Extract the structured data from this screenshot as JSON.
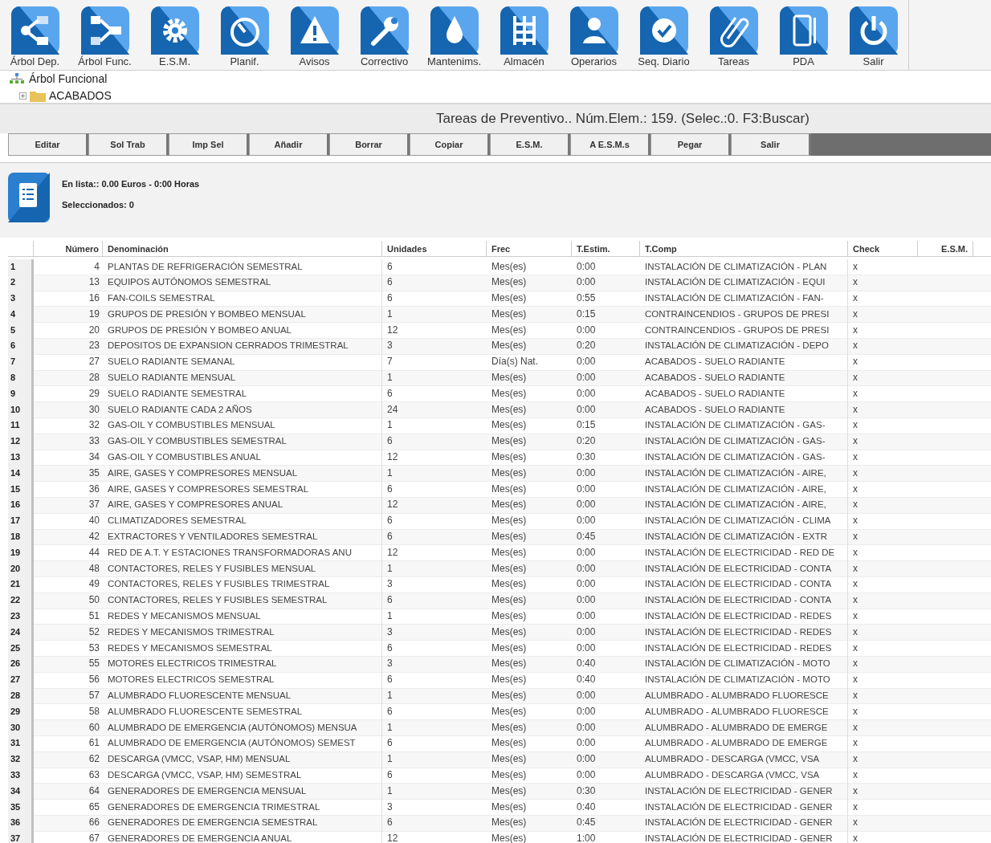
{
  "toolbar": [
    {
      "label": "Árbol Dep."
    },
    {
      "label": "Árbol Func."
    },
    {
      "label": "E.S.M."
    },
    {
      "label": "Planif."
    },
    {
      "label": "Avisos"
    },
    {
      "label": "Correctivo"
    },
    {
      "label": "Mantenims."
    },
    {
      "label": "Almacén"
    },
    {
      "label": "Operarios"
    },
    {
      "label": "Seq. Diario"
    },
    {
      "label": "Tareas"
    },
    {
      "label": "PDA"
    },
    {
      "label": "Salir"
    }
  ],
  "tree": {
    "root": "Árbol Funcional",
    "children": [
      {
        "label": "ACABADOS"
      }
    ]
  },
  "panel_title": "Tareas de Preventivo.. Núm.Elem.: 159. (Selec.:0. F3:Buscar)",
  "actions": [
    "Editar",
    "Sol Trab",
    "Imp Sel",
    "Añadir",
    "Borrar",
    "Copiar",
    "E.S.M.",
    "A E.S.M.s",
    "Pegar",
    "Salir"
  ],
  "summary": {
    "list": "En lista:: 0.00 Euros - 0:00 Horas",
    "selected": "Seleccionados: 0"
  },
  "table": {
    "columns": [
      "",
      "Número",
      "Denominación",
      "Unidades",
      "Frec",
      "T.Estim.",
      "T.Comp",
      "Check",
      "E.S.M."
    ],
    "rows": [
      [
        "1",
        "4",
        "PLANTAS DE REFRIGERACIÓN SEMESTRAL",
        "6",
        "Mes(es)",
        "0:00",
        "INSTALACIÓN DE CLIMATIZACIÓN - PLAN",
        "x"
      ],
      [
        "2",
        "13",
        "EQUIPOS AUTÓNOMOS SEMESTRAL",
        "6",
        "Mes(es)",
        "0:00",
        "INSTALACIÓN DE CLIMATIZACIÓN - EQUI",
        "x"
      ],
      [
        "3",
        "16",
        "FAN-COILS SEMESTRAL",
        "6",
        "Mes(es)",
        "0:55",
        "INSTALACIÓN DE CLIMATIZACIÓN - FAN-",
        "x"
      ],
      [
        "4",
        "19",
        "GRUPOS DE PRESIÓN Y BOMBEO MENSUAL",
        "1",
        "Mes(es)",
        "0:15",
        "CONTRAINCENDIOS - GRUPOS DE PRESI",
        "x"
      ],
      [
        "5",
        "20",
        "GRUPOS DE PRESIÓN Y BOMBEO ANUAL",
        "12",
        "Mes(es)",
        "0:00",
        "CONTRAINCENDIOS - GRUPOS DE PRESI",
        "x"
      ],
      [
        "6",
        "23",
        "DEPOSITOS DE EXPANSION CERRADOS TRIMESTRAL",
        "3",
        "Mes(es)",
        "0:20",
        "INSTALACIÓN DE CLIMATIZACIÓN - DEPO",
        "x"
      ],
      [
        "7",
        "27",
        "SUELO RADIANTE SEMANAL",
        "7",
        "Día(s) Nat.",
        "0:00",
        "ACABADOS - SUELO RADIANTE",
        "x"
      ],
      [
        "8",
        "28",
        "SUELO RADIANTE MENSUAL",
        "1",
        "Mes(es)",
        "0:00",
        "ACABADOS - SUELO RADIANTE",
        "x"
      ],
      [
        "9",
        "29",
        "SUELO RADIANTE SEMESTRAL",
        "6",
        "Mes(es)",
        "0:00",
        "ACABADOS - SUELO RADIANTE",
        "x"
      ],
      [
        "10",
        "30",
        "SUELO RADIANTE CADA 2 AÑOS",
        "24",
        "Mes(es)",
        "0:00",
        "ACABADOS - SUELO RADIANTE",
        "x"
      ],
      [
        "11",
        "32",
        "GAS-OIL Y COMBUSTIBLES MENSUAL",
        "1",
        "Mes(es)",
        "0:15",
        "INSTALACIÓN DE CLIMATIZACIÓN - GAS-",
        "x"
      ],
      [
        "12",
        "33",
        "GAS-OIL Y COMBUSTIBLES SEMESTRAL",
        "6",
        "Mes(es)",
        "0:20",
        "INSTALACIÓN DE CLIMATIZACIÓN - GAS-",
        "x"
      ],
      [
        "13",
        "34",
        "GAS-OIL Y COMBUSTIBLES ANUAL",
        "12",
        "Mes(es)",
        "0:30",
        "INSTALACIÓN DE CLIMATIZACIÓN - GAS-",
        "x"
      ],
      [
        "14",
        "35",
        "AIRE, GASES Y COMPRESORES MENSUAL",
        "1",
        "Mes(es)",
        "0:00",
        "INSTALACIÓN DE CLIMATIZACIÓN - AIRE,",
        "x"
      ],
      [
        "15",
        "36",
        "AIRE, GASES Y COMPRESORES SEMESTRAL",
        "6",
        "Mes(es)",
        "0:00",
        "INSTALACIÓN DE CLIMATIZACIÓN - AIRE,",
        "x"
      ],
      [
        "16",
        "37",
        "AIRE, GASES Y COMPRESORES ANUAL",
        "12",
        "Mes(es)",
        "0:00",
        "INSTALACIÓN DE CLIMATIZACIÓN - AIRE,",
        "x"
      ],
      [
        "17",
        "40",
        "CLIMATIZADORES SEMESTRAL",
        "6",
        "Mes(es)",
        "0:00",
        "INSTALACIÓN DE CLIMATIZACIÓN - CLIMA",
        "x"
      ],
      [
        "18",
        "42",
        "EXTRACTORES Y VENTILADORES SEMESTRAL",
        "6",
        "Mes(es)",
        "0:45",
        "INSTALACIÓN DE CLIMATIZACIÓN - EXTR",
        "x"
      ],
      [
        "19",
        "44",
        "RED DE A.T. Y ESTACIONES TRANSFORMADORAS ANU",
        "12",
        "Mes(es)",
        "0:00",
        "INSTALACIÓN DE ELECTRICIDAD - RED DE",
        "x"
      ],
      [
        "20",
        "48",
        "CONTACTORES, RELES Y FUSIBLES MENSUAL",
        "1",
        "Mes(es)",
        "0:00",
        "INSTALACIÓN DE ELECTRICIDAD - CONTA",
        "x"
      ],
      [
        "21",
        "49",
        "CONTACTORES, RELES Y FUSIBLES TRIMESTRAL",
        "3",
        "Mes(es)",
        "0:00",
        "INSTALACIÓN DE ELECTRICIDAD - CONTA",
        "x"
      ],
      [
        "22",
        "50",
        "CONTACTORES, RELES Y FUSIBLES SEMESTRAL",
        "6",
        "Mes(es)",
        "0:00",
        "INSTALACIÓN DE ELECTRICIDAD - CONTA",
        "x"
      ],
      [
        "23",
        "51",
        "REDES Y MECANISMOS MENSUAL",
        "1",
        "Mes(es)",
        "0:00",
        "INSTALACIÓN DE ELECTRICIDAD - REDES",
        "x"
      ],
      [
        "24",
        "52",
        "REDES Y MECANISMOS TRIMESTRAL",
        "3",
        "Mes(es)",
        "0:00",
        "INSTALACIÓN DE ELECTRICIDAD - REDES",
        "x"
      ],
      [
        "25",
        "53",
        "REDES Y MECANISMOS SEMESTRAL",
        "6",
        "Mes(es)",
        "0:00",
        "INSTALACIÓN DE ELECTRICIDAD - REDES",
        "x"
      ],
      [
        "26",
        "55",
        "MOTORES ELECTRICOS TRIMESTRAL",
        "3",
        "Mes(es)",
        "0:40",
        "INSTALACIÓN DE CLIMATIZACIÓN - MOTO",
        "x"
      ],
      [
        "27",
        "56",
        "MOTORES ELECTRICOS SEMESTRAL",
        "6",
        "Mes(es)",
        "0:40",
        "INSTALACIÓN DE CLIMATIZACIÓN - MOTO",
        "x"
      ],
      [
        "28",
        "57",
        "ALUMBRADO FLUORESCENTE MENSUAL",
        "1",
        "Mes(es)",
        "0:00",
        "ALUMBRADO - ALUMBRADO FLUORESCE",
        "x"
      ],
      [
        "29",
        "58",
        "ALUMBRADO FLUORESCENTE SEMESTRAL",
        "6",
        "Mes(es)",
        "0:00",
        "ALUMBRADO - ALUMBRADO FLUORESCE",
        "x"
      ],
      [
        "30",
        "60",
        "ALUMBRADO DE EMERGENCIA (AUTÓNOMOS) MENSUA",
        "1",
        "Mes(es)",
        "0:00",
        "ALUMBRADO - ALUMBRADO DE EMERGE",
        "x"
      ],
      [
        "31",
        "61",
        "ALUMBRADO DE EMERGENCIA (AUTÓNOMOS) SEMEST",
        "6",
        "Mes(es)",
        "0:00",
        "ALUMBRADO - ALUMBRADO DE EMERGE",
        "x"
      ],
      [
        "32",
        "62",
        "DESCARGA (VMCC, VSAP, HM) MENSUAL",
        "1",
        "Mes(es)",
        "0:00",
        "ALUMBRADO - DESCARGA (VMCC, VSA",
        "x"
      ],
      [
        "33",
        "63",
        "DESCARGA (VMCC, VSAP, HM) SEMESTRAL",
        "6",
        "Mes(es)",
        "0:00",
        "ALUMBRADO - DESCARGA (VMCC, VSA",
        "x"
      ],
      [
        "34",
        "64",
        "GENERADORES DE EMERGENCIA MENSUAL",
        "1",
        "Mes(es)",
        "0:30",
        "INSTALACIÓN DE ELECTRICIDAD - GENER",
        "x"
      ],
      [
        "35",
        "65",
        "GENERADORES DE EMERGENCIA TRIMESTRAL",
        "3",
        "Mes(es)",
        "0:40",
        "INSTALACIÓN DE ELECTRICIDAD - GENER",
        "x"
      ],
      [
        "36",
        "66",
        "GENERADORES DE EMERGENCIA SEMESTRAL",
        "6",
        "Mes(es)",
        "0:45",
        "INSTALACIÓN DE ELECTRICIDAD - GENER",
        "x"
      ],
      [
        "37",
        "67",
        "GENERADORES DE EMERGENCIA ANUAL",
        "12",
        "Mes(es)",
        "1:00",
        "INSTALACIÓN DE ELECTRICIDAD - GENER",
        "x"
      ]
    ]
  }
}
